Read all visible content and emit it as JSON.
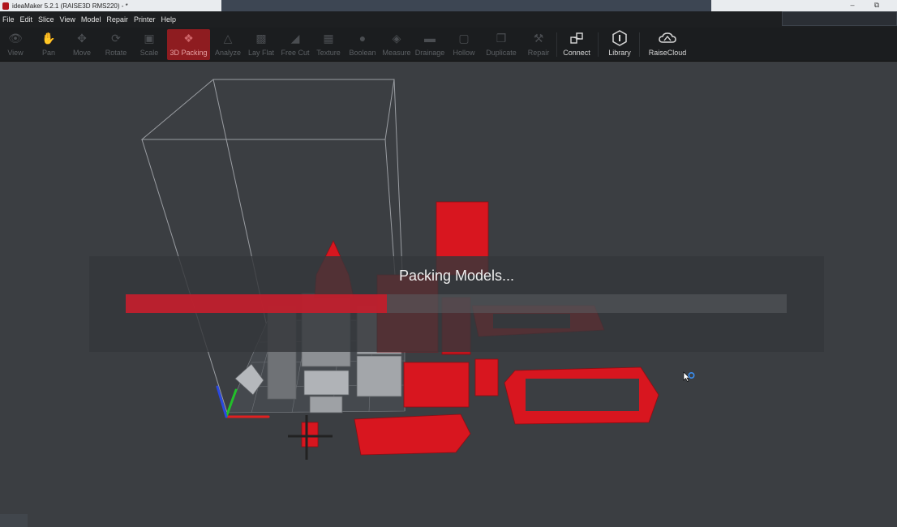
{
  "titlebar": {
    "title": "ideaMaker 5.2.1 (RAISE3D RMS220) - *",
    "icon": "ideamaker-logo-icon",
    "controls": [
      "minimize-icon",
      "restore-icon"
    ]
  },
  "menu": {
    "items": [
      "File",
      "Edit",
      "Slice",
      "View",
      "Model",
      "Repair",
      "Printer",
      "Help"
    ]
  },
  "toolbar": {
    "tools": [
      {
        "label": "View",
        "icon": "eye-icon",
        "state": "disabled"
      },
      {
        "label": "Pan",
        "icon": "hand-icon",
        "state": "disabled"
      },
      {
        "label": "Move",
        "icon": "move-icon",
        "state": "disabled"
      },
      {
        "label": "Rotate",
        "icon": "rotate-icon",
        "state": "disabled"
      },
      {
        "label": "Scale",
        "icon": "scale-icon",
        "state": "disabled"
      },
      {
        "label": "3D Packing",
        "icon": "packing-icon",
        "state": "active"
      },
      {
        "label": "Analyze",
        "icon": "analyze-icon",
        "state": "disabled"
      },
      {
        "label": "Lay Flat",
        "icon": "lay-flat-icon",
        "state": "disabled"
      },
      {
        "label": "Free Cut",
        "icon": "cut-icon",
        "state": "disabled"
      },
      {
        "label": "Texture",
        "icon": "texture-icon",
        "state": "disabled"
      },
      {
        "label": "Boolean",
        "icon": "boolean-icon",
        "state": "disabled"
      },
      {
        "label": "Measure",
        "icon": "ruler-icon",
        "state": "disabled"
      },
      {
        "label": "Drainage",
        "icon": "drainage-icon",
        "state": "disabled"
      },
      {
        "label": "Hollow",
        "icon": "hollow-icon",
        "state": "disabled"
      },
      {
        "label": "Duplicate",
        "icon": "duplicate-icon",
        "state": "disabled"
      },
      {
        "label": "Repair",
        "icon": "wrench-icon",
        "state": "disabled"
      },
      {
        "label": "Connect",
        "icon": "connect-icon",
        "state": "enabled"
      },
      {
        "label": "Library",
        "icon": "library-icon",
        "state": "enabled"
      },
      {
        "label": "RaiseCloud",
        "icon": "cloud-icon",
        "state": "enabled"
      }
    ]
  },
  "progress": {
    "message": "Packing Models...",
    "fraction": 0.395
  },
  "colors": {
    "accent": "#cd1928",
    "model_red": "#d8161f",
    "model_gray": "#8e9094",
    "viewport_bg": "#3b3e42"
  }
}
